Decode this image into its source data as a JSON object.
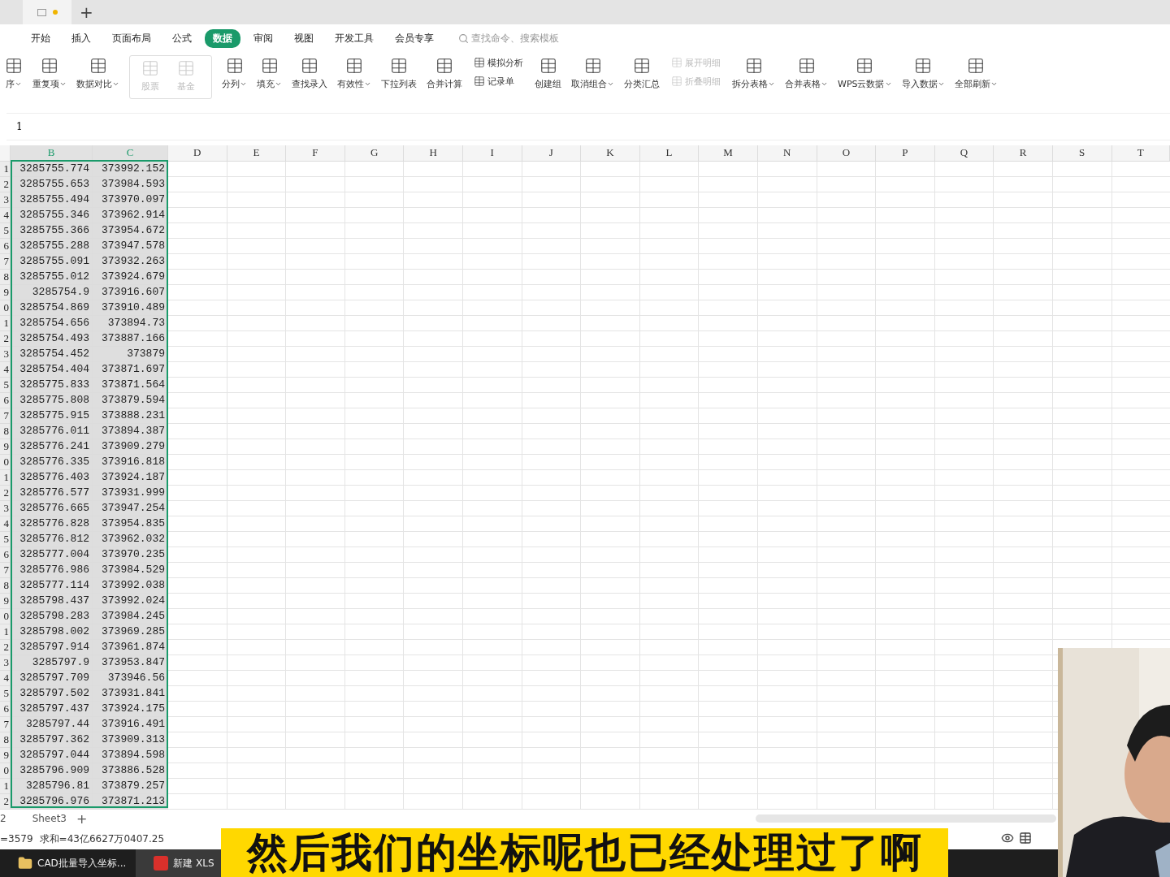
{
  "title_bar": {
    "new_tab": "+"
  },
  "menu": {
    "tabs": [
      {
        "label": "开始",
        "selected": false
      },
      {
        "label": "插入",
        "selected": false
      },
      {
        "label": "页面布局",
        "selected": false
      },
      {
        "label": "公式",
        "selected": false
      },
      {
        "label": "数据",
        "selected": true
      },
      {
        "label": "审阅",
        "selected": false
      },
      {
        "label": "视图",
        "selected": false
      },
      {
        "label": "开发工具",
        "selected": false
      },
      {
        "label": "会员专享",
        "selected": false
      }
    ],
    "search": {
      "placeholder": "查找命令、搜索模板"
    }
  },
  "ribbon": [
    {
      "kind": "large",
      "label": "序",
      "dropdown": true
    },
    {
      "kind": "large",
      "label": "重复项",
      "dropdown": true
    },
    {
      "kind": "large",
      "label": "数据对比",
      "dropdown": true
    },
    {
      "kind": "gallery",
      "items": [
        {
          "label": "股票",
          "disabled": true
        },
        {
          "label": "基金",
          "disabled": true
        }
      ]
    },
    {
      "kind": "large",
      "label": "分列",
      "dropdown": true
    },
    {
      "kind": "large",
      "label": "填充",
      "dropdown": true
    },
    {
      "kind": "large",
      "label": "查找录入",
      "dropdown": false
    },
    {
      "kind": "large",
      "label": "有效性",
      "dropdown": true
    },
    {
      "kind": "large",
      "label": "下拉列表",
      "dropdown": false
    },
    {
      "kind": "large",
      "label": "合并计算",
      "dropdown": false
    },
    {
      "kind": "stack",
      "items": [
        {
          "label": "模拟分析",
          "disabled": false
        },
        {
          "label": "记录单",
          "disabled": false
        }
      ]
    },
    {
      "kind": "large",
      "label": "创建组",
      "dropdown": false
    },
    {
      "kind": "large",
      "label": "取消组合",
      "dropdown": true
    },
    {
      "kind": "large",
      "label": "分类汇总",
      "dropdown": false
    },
    {
      "kind": "stack",
      "items": [
        {
          "label": "展开明细",
          "disabled": true
        },
        {
          "label": "折叠明细",
          "disabled": true
        }
      ]
    },
    {
      "kind": "large",
      "label": "拆分表格",
      "dropdown": true
    },
    {
      "kind": "large",
      "label": "合并表格",
      "dropdown": true
    },
    {
      "kind": "large",
      "label": "WPS云数据",
      "dropdown": true
    },
    {
      "kind": "large",
      "label": "导入数据",
      "dropdown": true
    },
    {
      "kind": "large",
      "label": "全部刷新",
      "dropdown": true
    }
  ],
  "formula_bar": {
    "value": "1"
  },
  "sheet": {
    "columns": [
      {
        "label": "B",
        "selected": true
      },
      {
        "label": "C",
        "selected": true
      },
      {
        "label": "D",
        "selected": false
      },
      {
        "label": "E",
        "selected": false
      },
      {
        "label": "F",
        "selected": false
      },
      {
        "label": "G",
        "selected": false
      },
      {
        "label": "H",
        "selected": false
      },
      {
        "label": "I",
        "selected": false
      },
      {
        "label": "J",
        "selected": false
      },
      {
        "label": "K",
        "selected": false
      },
      {
        "label": "L",
        "selected": false
      },
      {
        "label": "M",
        "selected": false
      },
      {
        "label": "N",
        "selected": false
      },
      {
        "label": "O",
        "selected": false
      },
      {
        "label": "P",
        "selected": false
      },
      {
        "label": "Q",
        "selected": false
      },
      {
        "label": "R",
        "selected": false
      },
      {
        "label": "S",
        "selected": false
      },
      {
        "label": "T",
        "selected": false
      }
    ],
    "rows": [
      {
        "header": "1",
        "cells": [
          "3285755.774",
          "373992.152"
        ]
      },
      {
        "header": "2",
        "cells": [
          "3285755.653",
          "373984.593"
        ]
      },
      {
        "header": "3",
        "cells": [
          "3285755.494",
          "373970.097"
        ]
      },
      {
        "header": "4",
        "cells": [
          "3285755.346",
          "373962.914"
        ]
      },
      {
        "header": "5",
        "cells": [
          "3285755.366",
          "373954.672"
        ]
      },
      {
        "header": "6",
        "cells": [
          "3285755.288",
          "373947.578"
        ]
      },
      {
        "header": "7",
        "cells": [
          "3285755.091",
          "373932.263"
        ]
      },
      {
        "header": "8",
        "cells": [
          "3285755.012",
          "373924.679"
        ]
      },
      {
        "header": "9",
        "cells": [
          "3285754.9",
          "373916.607"
        ]
      },
      {
        "header": "0",
        "cells": [
          "3285754.869",
          "373910.489"
        ]
      },
      {
        "header": "1",
        "cells": [
          "3285754.656",
          "373894.73"
        ]
      },
      {
        "header": "2",
        "cells": [
          "3285754.493",
          "373887.166"
        ]
      },
      {
        "header": "3",
        "cells": [
          "3285754.452",
          "373879"
        ]
      },
      {
        "header": "4",
        "cells": [
          "3285754.404",
          "373871.697"
        ]
      },
      {
        "header": "5",
        "cells": [
          "3285775.833",
          "373871.564"
        ]
      },
      {
        "header": "6",
        "cells": [
          "3285775.808",
          "373879.594"
        ]
      },
      {
        "header": "7",
        "cells": [
          "3285775.915",
          "373888.231"
        ]
      },
      {
        "header": "8",
        "cells": [
          "3285776.011",
          "373894.387"
        ]
      },
      {
        "header": "9",
        "cells": [
          "3285776.241",
          "373909.279"
        ]
      },
      {
        "header": "0",
        "cells": [
          "3285776.335",
          "373916.818"
        ]
      },
      {
        "header": "1",
        "cells": [
          "3285776.403",
          "373924.187"
        ]
      },
      {
        "header": "2",
        "cells": [
          "3285776.577",
          "373931.999"
        ]
      },
      {
        "header": "3",
        "cells": [
          "3285776.665",
          "373947.254"
        ]
      },
      {
        "header": "4",
        "cells": [
          "3285776.828",
          "373954.835"
        ]
      },
      {
        "header": "5",
        "cells": [
          "3285776.812",
          "373962.032"
        ]
      },
      {
        "header": "6",
        "cells": [
          "3285777.004",
          "373970.235"
        ]
      },
      {
        "header": "7",
        "cells": [
          "3285776.986",
          "373984.529"
        ]
      },
      {
        "header": "8",
        "cells": [
          "3285777.114",
          "373992.038"
        ]
      },
      {
        "header": "9",
        "cells": [
          "3285798.437",
          "373992.024"
        ]
      },
      {
        "header": "0",
        "cells": [
          "3285798.283",
          "373984.245"
        ]
      },
      {
        "header": "1",
        "cells": [
          "3285798.002",
          "373969.285"
        ]
      },
      {
        "header": "2",
        "cells": [
          "3285797.914",
          "373961.874"
        ]
      },
      {
        "header": "3",
        "cells": [
          "3285797.9",
          "373953.847"
        ]
      },
      {
        "header": "4",
        "cells": [
          "3285797.709",
          "373946.56"
        ]
      },
      {
        "header": "5",
        "cells": [
          "3285797.502",
          "373931.841"
        ]
      },
      {
        "header": "6",
        "cells": [
          "3285797.437",
          "373924.175"
        ]
      },
      {
        "header": "7",
        "cells": [
          "3285797.44",
          "373916.491"
        ]
      },
      {
        "header": "8",
        "cells": [
          "3285797.362",
          "373909.313"
        ]
      },
      {
        "header": "9",
        "cells": [
          "3285797.044",
          "373894.598"
        ]
      },
      {
        "header": "0",
        "cells": [
          "3285796.909",
          "373886.528"
        ]
      },
      {
        "header": "1",
        "cells": [
          "3285796.81",
          "373879.257"
        ]
      },
      {
        "header": "2",
        "cells": [
          "3285796.976",
          "373871.213"
        ]
      }
    ]
  },
  "sheet_tabs": {
    "partial": "2",
    "tabs": [
      {
        "label": "Sheet3",
        "selected": false
      }
    ],
    "add": "+"
  },
  "status_bar": {
    "count": "=3579",
    "sum": "求和=43亿6627万0407.25"
  },
  "taskbar": [
    {
      "label": "CAD批量导入坐标..."
    },
    {
      "label": "新建 XLS"
    }
  ],
  "subtitle": "然后我们的坐标呢也已经处理过了啊"
}
